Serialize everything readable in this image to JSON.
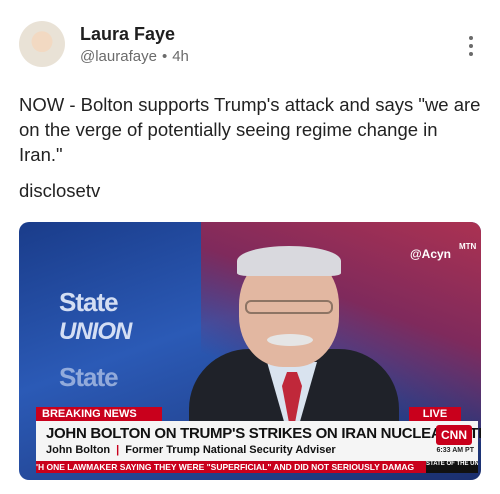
{
  "author": {
    "name": "Laura Faye",
    "handle": "@laurafaye",
    "separator": "•",
    "time": "4h"
  },
  "post": {
    "text": "NOW - Bolton supports Trump's attack and says \"we are on the verge of potentially seeing regime change in Iran.\"",
    "source_tag": "disclosetv"
  },
  "media": {
    "watermark": "@Acyn",
    "watermark_logo": "MTN",
    "show_logo_line1": "State",
    "show_logo_line2": "UNION",
    "breaking_label": "BREAKING NEWS",
    "live_label": "LIVE",
    "headline": "JOHN BOLTON ON TRUMP'S STRIKES ON IRAN NUCLEAR SITES",
    "speaker_name": "John Bolton",
    "speaker_sep": "|",
    "speaker_title": "Former Trump National Security Adviser",
    "network": "CNN",
    "timestamp": "6:33 AM PT",
    "ticker": "'H ONE LAWMAKER SAYING THEY WERE \"SUPERFICIAL\" AND DID NOT SERIOUSLY DAMAG",
    "ticker_logo": "STATE OF THE UNION"
  },
  "colors": {
    "cnn_red": "#c9001c",
    "text": "#222222",
    "meta": "#6b6b6b"
  }
}
